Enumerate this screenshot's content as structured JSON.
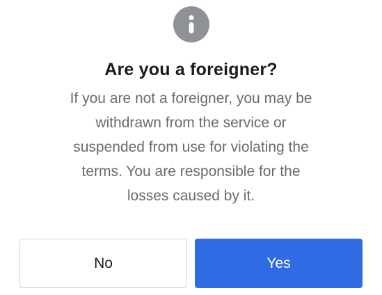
{
  "dialog": {
    "icon": "info-icon",
    "title": "Are you a foreigner?",
    "message_lines": [
      "If you are not a foreigner, you may be",
      "withdrawn from the service or",
      "suspended from use for violating the",
      "terms. You are responsible for the",
      "losses caused by it."
    ],
    "buttons": {
      "no_label": "No",
      "yes_label": "Yes"
    }
  },
  "colors": {
    "primary": "#2f6be3",
    "icon_background": "#8e9196",
    "title_text": "#1c1c1c",
    "message_text": "#6a6a6a",
    "secondary_border": "#d4d4d4"
  }
}
